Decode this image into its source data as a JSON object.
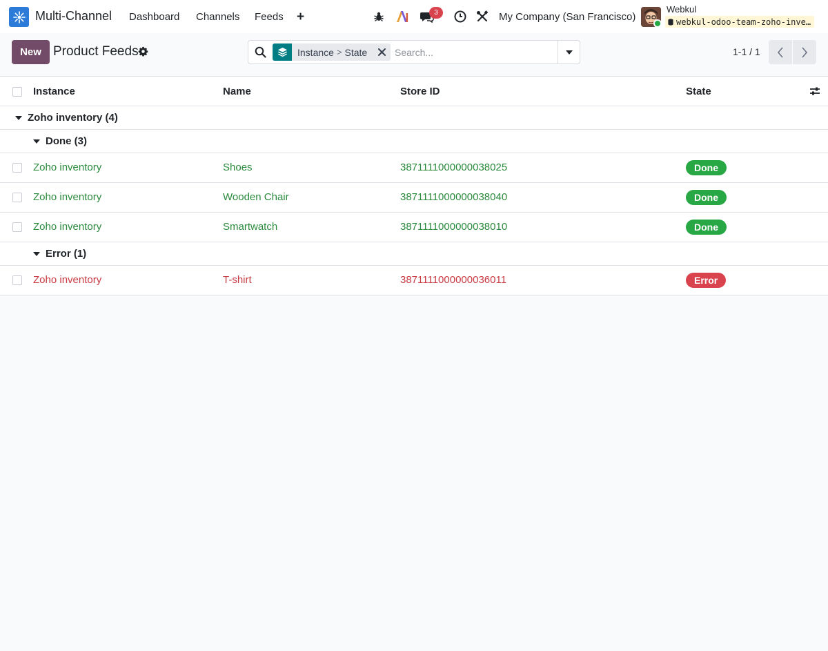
{
  "navbar": {
    "app_name": "Multi-Channel",
    "menu": [
      "Dashboard",
      "Channels",
      "Feeds"
    ],
    "plus_label": "+",
    "messages_count": "3",
    "company": "My Company (San Francisco)",
    "user_name": "Webkul",
    "database": "webkul-odoo-team-zoho-inventory"
  },
  "control": {
    "new_label": "New",
    "title": "Product Feeds",
    "facet_group1": "Instance",
    "facet_sep": ">",
    "facet_group2": "State",
    "search_placeholder": "Search...",
    "pager": "1-1 / 1"
  },
  "list": {
    "columns": [
      "Instance",
      "Name",
      "Store ID",
      "State"
    ],
    "groups": [
      {
        "label": "Zoho inventory (4)"
      },
      {
        "label": "Done (3)"
      },
      {
        "label": "Error (1)"
      }
    ],
    "rows": [
      {
        "instance": "Zoho inventory",
        "name": "Shoes",
        "store_id": "3871111000000038025",
        "state": "Done"
      },
      {
        "instance": "Zoho inventory",
        "name": "Wooden Chair",
        "store_id": "3871111000000038040",
        "state": "Done"
      },
      {
        "instance": "Zoho inventory",
        "name": "Smartwatch",
        "store_id": "3871111000000038010",
        "state": "Done"
      },
      {
        "instance": "Zoho inventory",
        "name": "T-shirt",
        "store_id": "3871111000000036011",
        "state": "Error"
      }
    ]
  },
  "colors": {
    "brand": "#714b67",
    "done": "#28a745",
    "error": "#d9434e",
    "facet": "#017e84"
  }
}
